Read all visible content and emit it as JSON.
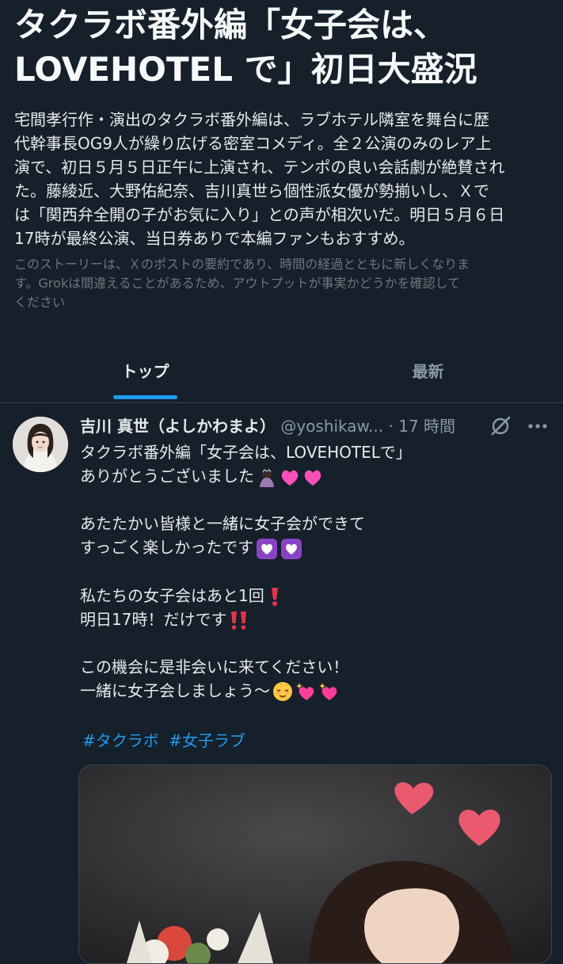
{
  "story": {
    "title_line1": "タクラボ番外編「女子会は、",
    "title_line2": "LOVEHOTEL で」初日大盛況",
    "summary_lines": [
      "宅間孝行作・演出のタクラボ番外編は、ラブホテル隣室を舞台に歴",
      "代幹事長OG9人が繰り広げる密室コメディ。全２公演のみのレア上",
      "演で、初日５月５日正午に上演され、テンポの良い会話劇が絶賛され",
      "た。藤綾近、大野佑紀奈、吉川真世ら個性派女優が勢揃いし、Ｘで",
      "は「関西弁全開の子がお気に入り」との声が相次いだ。明日５月６日",
      "17時が最終公演、当日券ありで本編ファンもおすすめ。"
    ],
    "disclaimer_lines": [
      "このストーリーは、Ｘのポストの要約であり、時間の経過とともに新しくなりま",
      "す。Grokは間違えることがあるため、アウトプットが事実かどうかを確認して",
      "ください"
    ]
  },
  "tabs": {
    "top": "トップ",
    "latest": "最新"
  },
  "post": {
    "author_name": "吉川 真世（よしかわまよ）",
    "handle": "@yoshikaw...",
    "separator": "·",
    "time": "17 時間",
    "lines": {
      "l1": "タクラボ番外編「女子会は、LOVEHOTELで」",
      "l2": "ありがとうございました",
      "l3": "あたたかい皆様と一緒に女子会ができて",
      "l4": "すっごく楽しかったです",
      "l5": "私たちの女子会はあと1回",
      "l6": "明日17時！だけです",
      "l7": "この機会に是非会いに来てください！",
      "l8": "一緒に女子会しましょう〜"
    },
    "hashtags": [
      "#タクラボ",
      "#女子ラブ"
    ]
  },
  "icons": {
    "grok": "grok-slash-icon",
    "more": "more-dots-icon"
  },
  "colors": {
    "background": "#15202b",
    "accent": "#1d9bf0",
    "secondary_text": "#8b98a5"
  }
}
